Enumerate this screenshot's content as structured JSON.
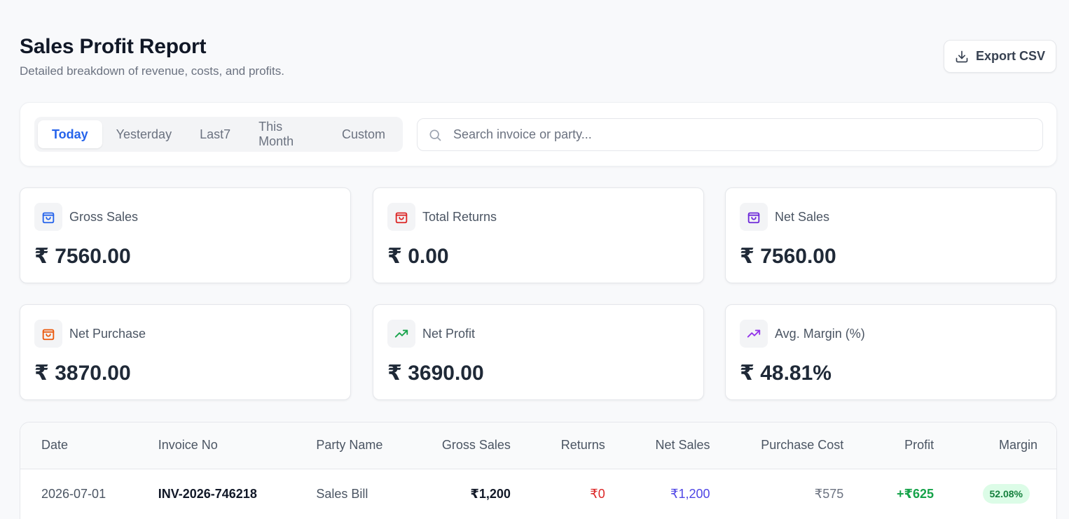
{
  "header": {
    "title": "Sales Profit Report",
    "subtitle": "Detailed breakdown of revenue, costs, and profits.",
    "export_label": "Export CSV",
    "export_icon": "download-icon"
  },
  "filters": {
    "tabs": [
      {
        "label": "Today",
        "active": true
      },
      {
        "label": "Yesterday",
        "active": false
      },
      {
        "label": "Last7",
        "active": false
      },
      {
        "label": "This Month",
        "active": false
      },
      {
        "label": "Custom",
        "active": false
      }
    ],
    "search": {
      "placeholder": "Search invoice or party...",
      "value": "",
      "icon": "search-icon"
    }
  },
  "stats": [
    {
      "label": "Gross Sales",
      "value": "₹ 7560.00",
      "icon": "shopping-bag-icon",
      "color": "#2563eb"
    },
    {
      "label": "Total Returns",
      "value": "₹ 0.00",
      "icon": "shopping-bag-icon",
      "color": "#dc2626"
    },
    {
      "label": "Net Sales",
      "value": "₹ 7560.00",
      "icon": "shopping-bag-icon",
      "color": "#6d28d9"
    },
    {
      "label": "Net Purchase",
      "value": "₹ 3870.00",
      "icon": "shopping-bag-icon",
      "color": "#ea580c"
    },
    {
      "label": "Net Profit",
      "value": "₹ 3690.00",
      "icon": "trending-up-icon",
      "color": "#16a34a"
    },
    {
      "label": "Avg. Margin (%)",
      "value": "₹ 48.81%",
      "icon": "trending-up-icon",
      "color": "#9333ea"
    }
  ],
  "table": {
    "columns": [
      "Date",
      "Invoice No",
      "Party Name",
      "Gross Sales",
      "Returns",
      "Net Sales",
      "Purchase Cost",
      "Profit",
      "Margin"
    ],
    "rows": [
      {
        "date": "2026-07-01",
        "invoice": "INV-2026-746218",
        "party": "Sales Bill",
        "gross": "₹1,200",
        "returns": "₹0",
        "net": "₹1,200",
        "purchase_cost": "₹575",
        "profit": "+₹625",
        "margin": "52.08%"
      }
    ]
  }
}
